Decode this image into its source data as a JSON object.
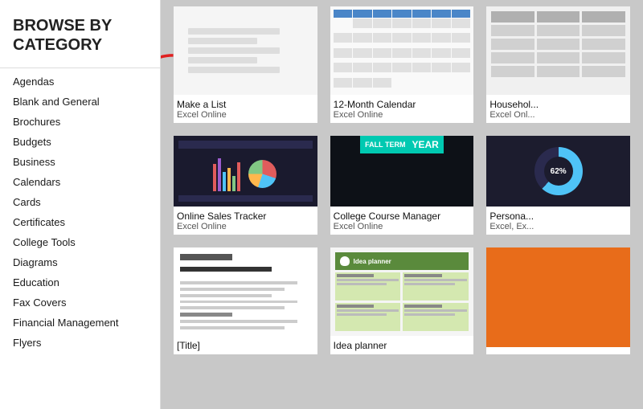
{
  "sidebar": {
    "browse_title": "BROWSE BY CATEGORY",
    "categories": [
      "Agendas",
      "Blank and General",
      "Brochures",
      "Budgets",
      "Business",
      "Calendars",
      "Cards",
      "Certificates",
      "College Tools",
      "Diagrams",
      "Education",
      "Fax Covers",
      "Financial Management",
      "Flyers"
    ]
  },
  "templates": {
    "row1": [
      {
        "name": "Make a List",
        "app": "Excel Online"
      },
      {
        "name": "12-Month Calendar",
        "app": "Excel Online"
      },
      {
        "name": "Househol...",
        "app": "Excel Onl..."
      }
    ],
    "row2": [
      {
        "name": "Online Sales Tracker",
        "app": "Excel Online"
      },
      {
        "name": "College Course Manager",
        "app": "Excel Online"
      },
      {
        "name": "Persona...",
        "app": "Excel, Ex..."
      }
    ],
    "row3": [
      {
        "name": "[Title]",
        "app": ""
      },
      {
        "name": "Idea planner",
        "app": ""
      },
      {
        "name": "",
        "app": ""
      }
    ]
  }
}
